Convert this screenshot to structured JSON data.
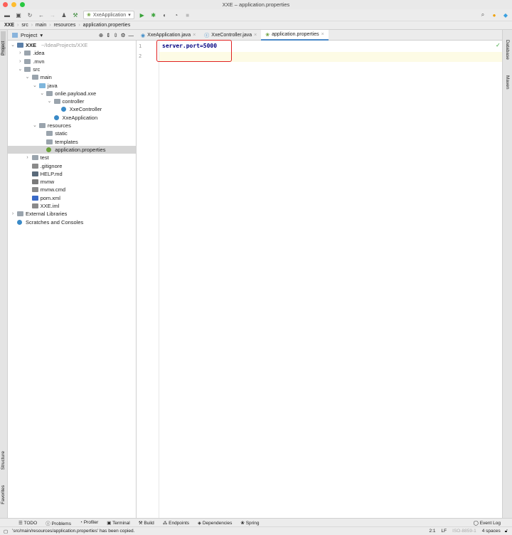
{
  "window": {
    "title": "XXE – application.properties"
  },
  "toolbar": {
    "run_config": "XxeApplication"
  },
  "breadcrumb": [
    "XXE",
    "src",
    "main",
    "resources",
    "application.properties"
  ],
  "left_stripe": {
    "project": "Project",
    "structure": "Structure",
    "favorites": "Favorites"
  },
  "right_stripe": {
    "database": "Database",
    "maven": "Maven"
  },
  "project_panel": {
    "title": "Project"
  },
  "tree": [
    {
      "label": "XXE",
      "extra": "~/IdeaProjects/XXE",
      "level": 0,
      "chevron": "down",
      "icon": "module"
    },
    {
      "label": ".idea",
      "level": 1,
      "chevron": "right",
      "icon": "folder"
    },
    {
      "label": ".mvn",
      "level": 1,
      "chevron": "right",
      "icon": "folder"
    },
    {
      "label": "src",
      "level": 1,
      "chevron": "down",
      "icon": "folder"
    },
    {
      "label": "main",
      "level": 2,
      "chevron": "down",
      "icon": "folder"
    },
    {
      "label": "java",
      "level": 3,
      "chevron": "down",
      "icon": "source-folder"
    },
    {
      "label": "onlie.payload.xxe",
      "level": 4,
      "chevron": "down",
      "icon": "package"
    },
    {
      "label": "controller",
      "level": 5,
      "chevron": "down",
      "icon": "package"
    },
    {
      "label": "XxeController",
      "level": 6,
      "icon": "class"
    },
    {
      "label": "XxeApplication",
      "level": 5,
      "icon": "spring-class"
    },
    {
      "label": "resources",
      "level": 3,
      "chevron": "down",
      "icon": "resource-folder"
    },
    {
      "label": "static",
      "level": 4,
      "icon": "folder"
    },
    {
      "label": "templates",
      "level": 4,
      "icon": "folder"
    },
    {
      "label": "application.properties",
      "level": 4,
      "icon": "properties",
      "selected": true
    },
    {
      "label": "test",
      "level": 2,
      "chevron": "right",
      "icon": "folder"
    },
    {
      "label": ".gitignore",
      "level": 2,
      "icon": "file"
    },
    {
      "label": "HELP.md",
      "level": 2,
      "icon": "markdown"
    },
    {
      "label": "mvnw",
      "level": 2,
      "icon": "script"
    },
    {
      "label": "mvnw.cmd",
      "level": 2,
      "icon": "file"
    },
    {
      "label": "pom.xml",
      "level": 2,
      "icon": "maven"
    },
    {
      "label": "XXE.iml",
      "level": 2,
      "icon": "file"
    },
    {
      "label": "External Libraries",
      "level": 0,
      "chevron": "right",
      "icon": "library"
    },
    {
      "label": "Scratches and Consoles",
      "level": 0,
      "icon": "scratches"
    }
  ],
  "tabs": [
    {
      "label": "XxeApplication.java"
    },
    {
      "label": "XxeController.java"
    },
    {
      "label": "application.properties",
      "active": true
    }
  ],
  "editor": {
    "lines": [
      "1",
      "2"
    ],
    "code": "server.port=5000"
  },
  "bottom_tools": [
    "TODO",
    "Problems",
    "Profiler",
    "Terminal",
    "Build",
    "Endpoints",
    "Dependencies",
    "Spring"
  ],
  "event_log": "Event Log",
  "status": {
    "message": "'src/main/resources/application.properties' has been copied.",
    "position": "2:1",
    "line_sep": "LF",
    "encoding": "ISO-8859-1",
    "indent": "4 spaces"
  }
}
